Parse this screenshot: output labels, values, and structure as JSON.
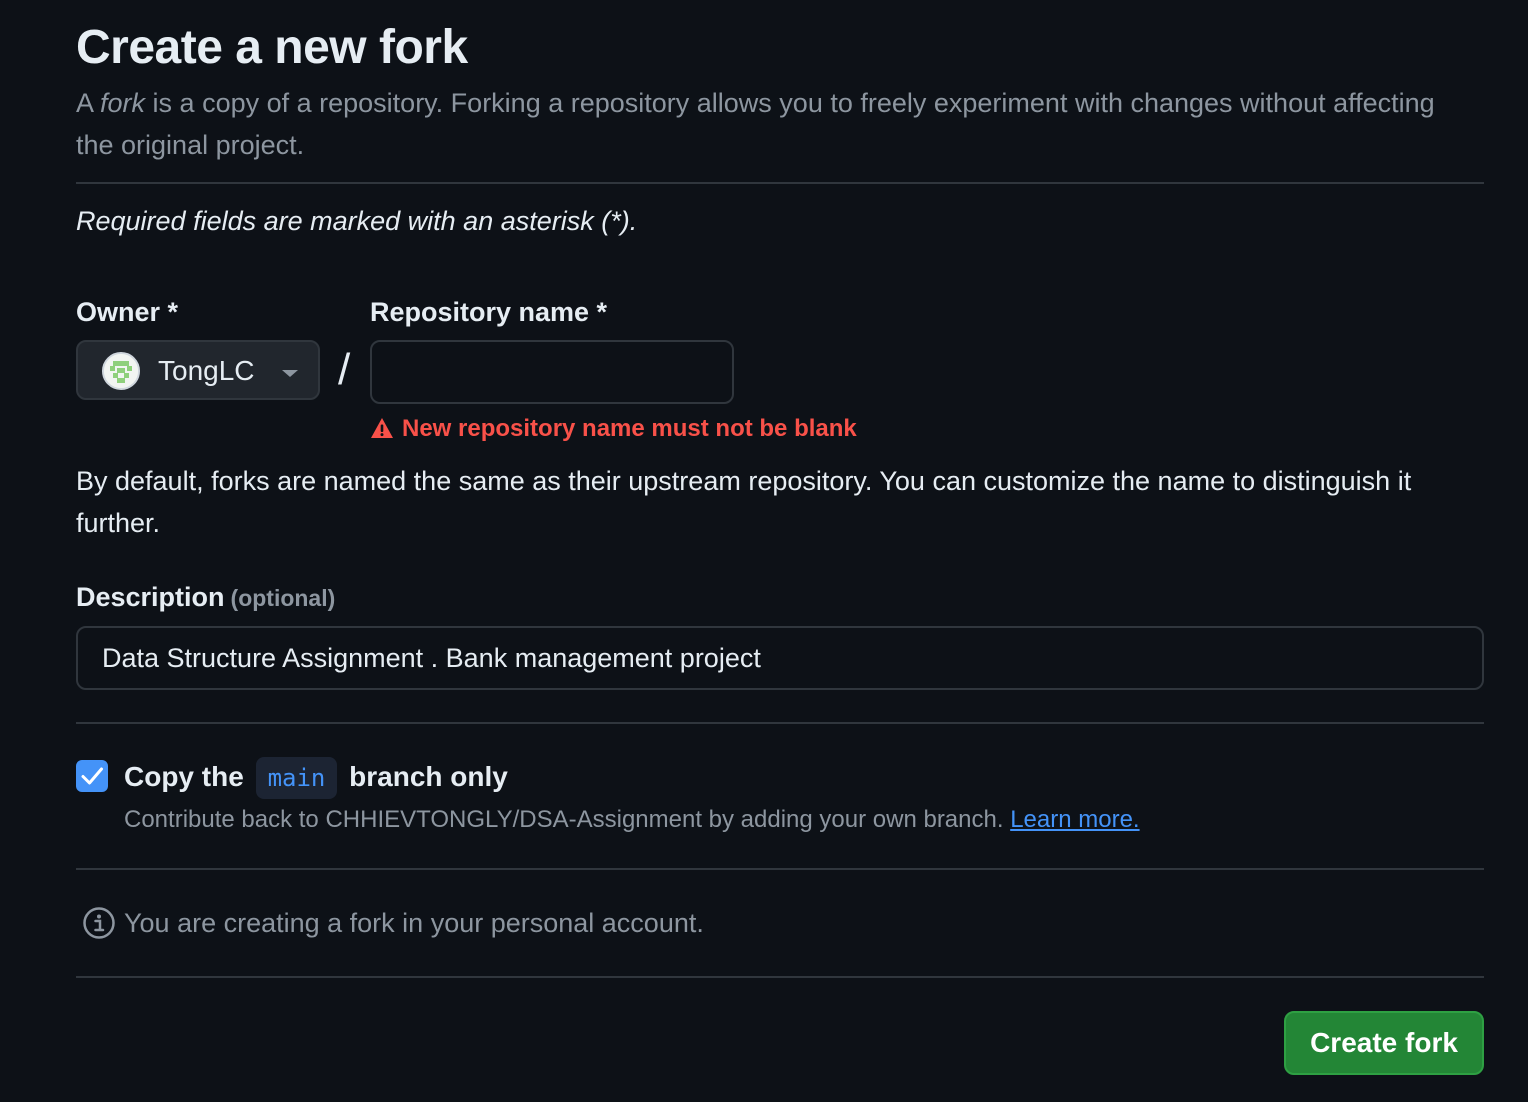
{
  "page": {
    "title": "Create a new fork",
    "intro_prefix": "A ",
    "intro_em": "fork",
    "intro_suffix": " is a copy of a repository. Forking a repository allows you to freely experiment with changes without affecting the original project.",
    "required_note": "Required fields are marked with an asterisk (*)."
  },
  "form": {
    "owner": {
      "label": "Owner *",
      "value": "TongLC",
      "icon": "chevron-down-icon"
    },
    "separator": "/",
    "repo_name": {
      "label": "Repository name *",
      "value": "",
      "placeholder": "",
      "error": "New repository name must not be blank",
      "error_icon": "alert-icon"
    },
    "helper": "By default, forks are named the same as their upstream repository. You can customize the name to distinguish it further.",
    "description": {
      "label": "Description",
      "optional": "(optional)",
      "value": "Data Structure Assignment . Bank management project"
    },
    "copy_branch": {
      "checked": true,
      "label_prefix": "Copy the",
      "branch": "main",
      "label_suffix": "branch only",
      "sub_prefix": "Contribute back to CHHIEVTONGLY/DSA-Assignment by adding your own branch.",
      "link": "Learn more."
    },
    "info": "You are creating a fork in your personal account.",
    "submit_label": "Create fork"
  },
  "colors": {
    "background": "#0d1117",
    "accent": "#4493f8",
    "danger": "#f85149",
    "primary_button": "#238636"
  }
}
